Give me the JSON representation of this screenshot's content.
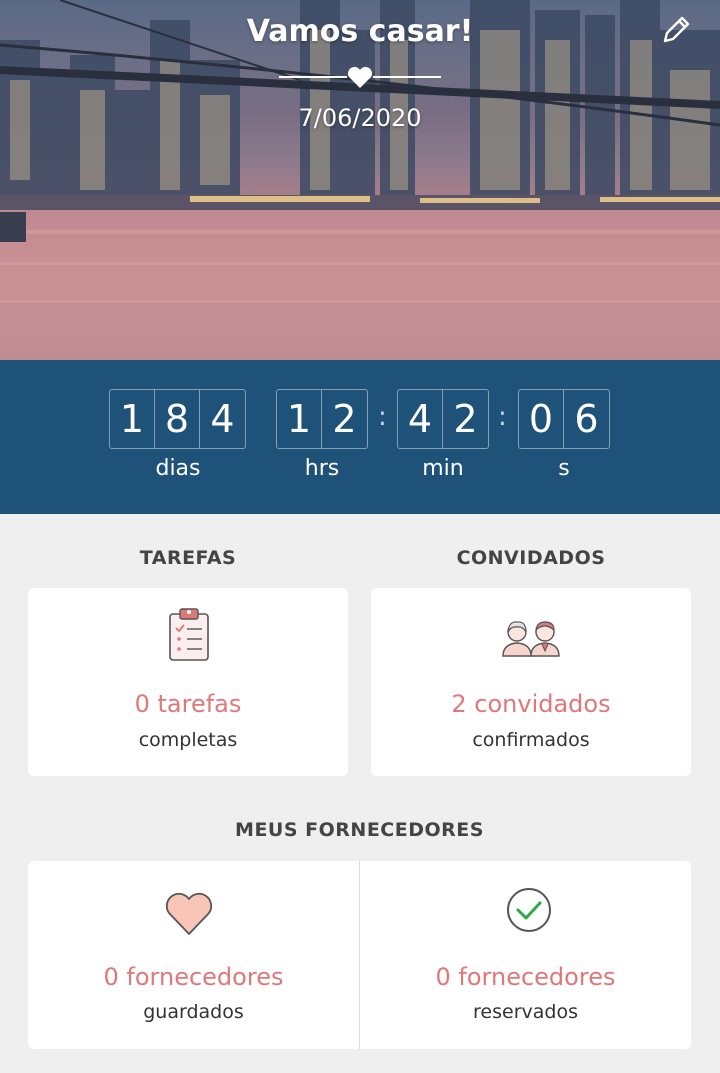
{
  "header": {
    "title": "Vamos casar!",
    "date": "7/06/2020"
  },
  "countdown": {
    "days_digits": [
      "1",
      "8",
      "4"
    ],
    "hours_digits": [
      "1",
      "2"
    ],
    "minutes_digits": [
      "4",
      "2"
    ],
    "seconds_digits": [
      "0",
      "6"
    ],
    "separator": ":",
    "labels": {
      "days": "dias",
      "hours": "hrs",
      "minutes": "min",
      "seconds": "s"
    }
  },
  "tasks": {
    "title": "TAREFAS",
    "value": "0 tarefas",
    "subtitle": "completas",
    "icon": "clipboard-icon"
  },
  "guests": {
    "title": "CONVIDADOS",
    "value": "2 convidados",
    "subtitle": "confirmados",
    "icon": "couple-icon"
  },
  "vendors": {
    "title": "MEUS FORNECEDORES",
    "saved": {
      "value": "0 fornecedores",
      "subtitle": "guardados",
      "icon": "heart-icon"
    },
    "booked": {
      "value": "0 fornecedores",
      "subtitle": "reservados",
      "icon": "check-circle-icon"
    }
  },
  "colors": {
    "countdown_bg": "#1f5279",
    "accent": "#e0787a",
    "page_bg": "#efefef"
  }
}
